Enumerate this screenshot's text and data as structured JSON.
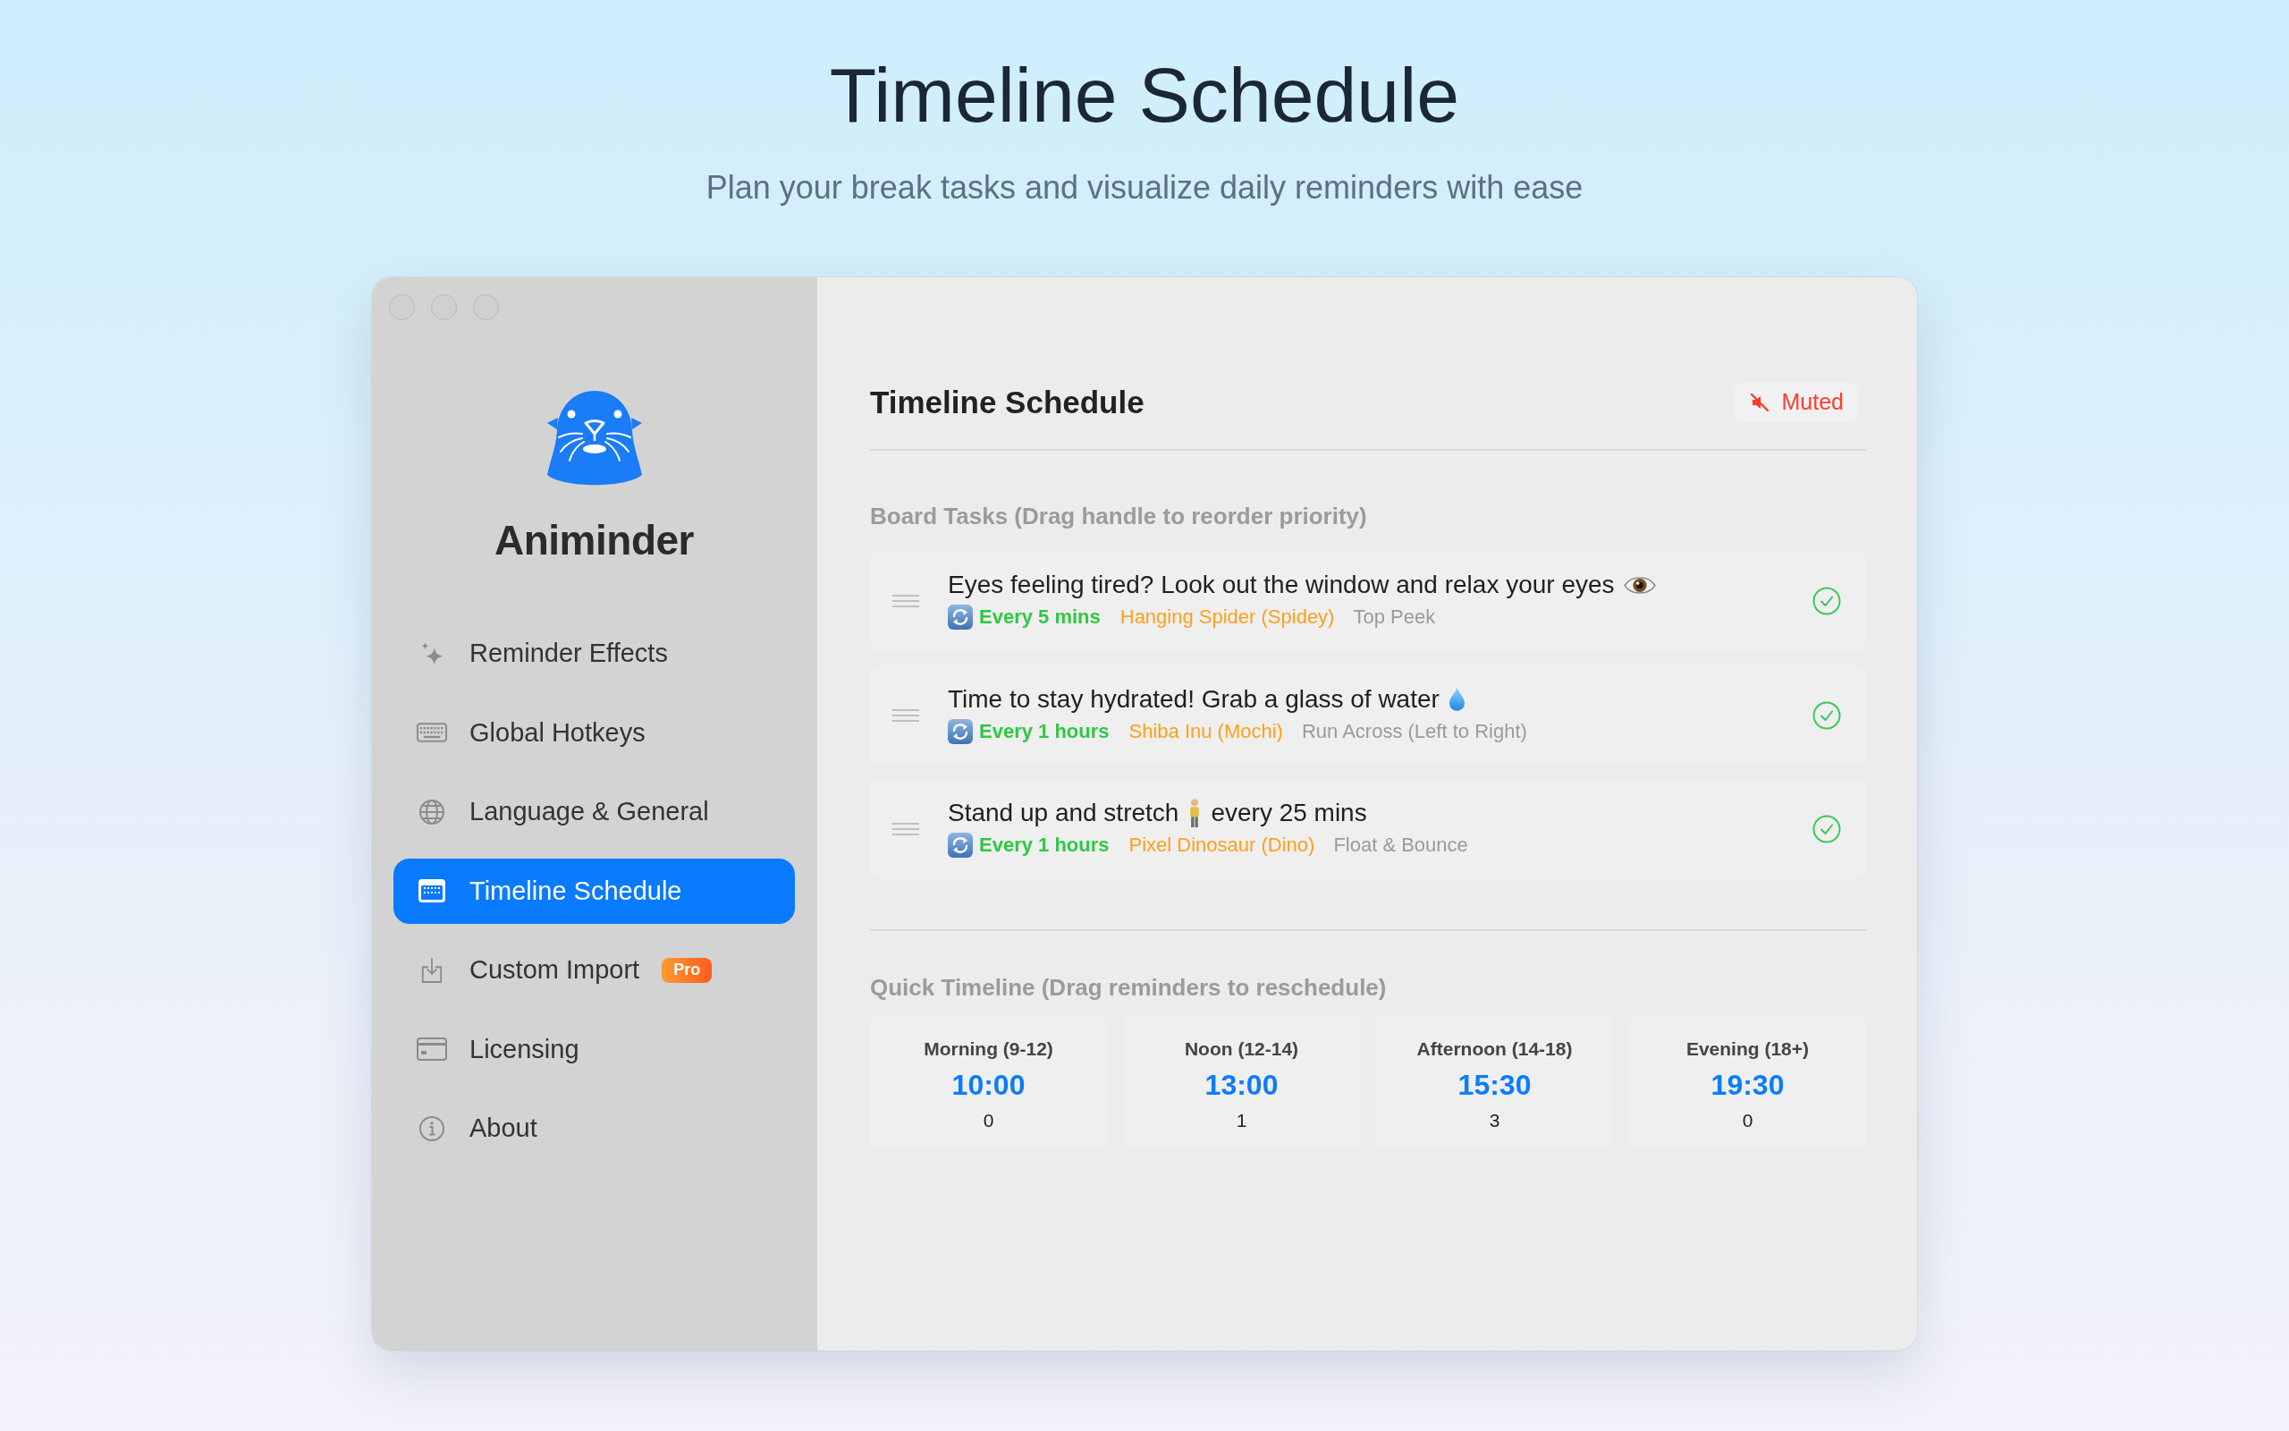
{
  "page": {
    "title": "Timeline Schedule",
    "subtitle": "Plan your break tasks and visualize daily reminders with ease"
  },
  "sidebar": {
    "app_name": "Animinder",
    "items": [
      {
        "label": "Reminder Effects",
        "selected": false
      },
      {
        "label": "Global Hotkeys",
        "selected": false
      },
      {
        "label": "Language & General",
        "selected": false
      },
      {
        "label": "Timeline Schedule",
        "selected": true
      },
      {
        "label": "Custom Import",
        "selected": false,
        "badge": "Pro"
      },
      {
        "label": "Licensing",
        "selected": false
      },
      {
        "label": "About",
        "selected": false
      }
    ]
  },
  "main": {
    "title": "Timeline Schedule",
    "status": {
      "label": "Muted",
      "muted": true
    },
    "board": {
      "heading": "Board Tasks (Drag handle to reorder priority)",
      "tasks": [
        {
          "title": [
            "Eyes feeling tired? Look out the window and relax your eyes"
          ],
          "interval": "Every 5 mins",
          "character": "Hanging Spider (Spidey)",
          "animation": "Top Peek",
          "enabled": true
        },
        {
          "title": [
            "Time to stay hydrated! Grab a glass of water"
          ],
          "interval": "Every 1 hours",
          "character": "Shiba Inu (Mochi)",
          "animation": "Run Across (Left to Right)",
          "enabled": true
        },
        {
          "title": [
            "Stand up and stretch",
            "every 25 mins"
          ],
          "interval": "Every 1 hours",
          "character": "Pixel Dinosaur (Dino)",
          "animation": "Float & Bounce",
          "enabled": true
        }
      ]
    },
    "timeline": {
      "heading": "Quick Timeline (Drag reminders to reschedule)",
      "slots": [
        {
          "label": "Morning (9-12)",
          "time": "10:00",
          "count": "0"
        },
        {
          "label": "Noon (12-14)",
          "time": "13:00",
          "count": "1"
        },
        {
          "label": "Afternoon (14-18)",
          "time": "15:30",
          "count": "3"
        },
        {
          "label": "Evening (18+)",
          "time": "19:30",
          "count": "0"
        }
      ]
    }
  }
}
